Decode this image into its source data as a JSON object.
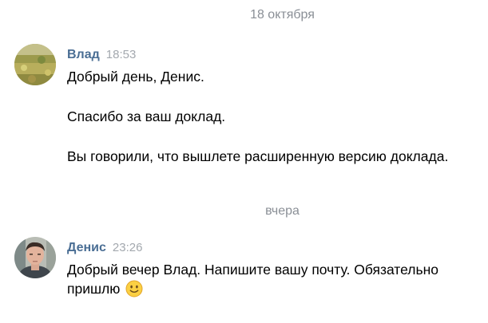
{
  "dates": {
    "first": "18 октября",
    "second": "вчера"
  },
  "messages": [
    {
      "author": "Влад",
      "time": "18:53",
      "paragraphs": [
        "Добрый день, Денис.",
        "Спасибо за ваш доклад.",
        "Вы говорили, что вышлете расширенную версию доклада."
      ],
      "avatar_icon": "landscape-avatar"
    },
    {
      "author": "Денис",
      "time": "23:26",
      "line1": "Добрый вечер Влад. Напишите вашу почту. Обязательно",
      "line2": "пришлю",
      "emoji_icon": "slightly-smiling-face-icon",
      "avatar_icon": "person-photo-avatar"
    }
  ],
  "colors": {
    "author": "#4a6e94",
    "time": "#a3a8ae",
    "date_divider": "#8a8f96",
    "text": "#000000",
    "background": "#ffffff"
  }
}
